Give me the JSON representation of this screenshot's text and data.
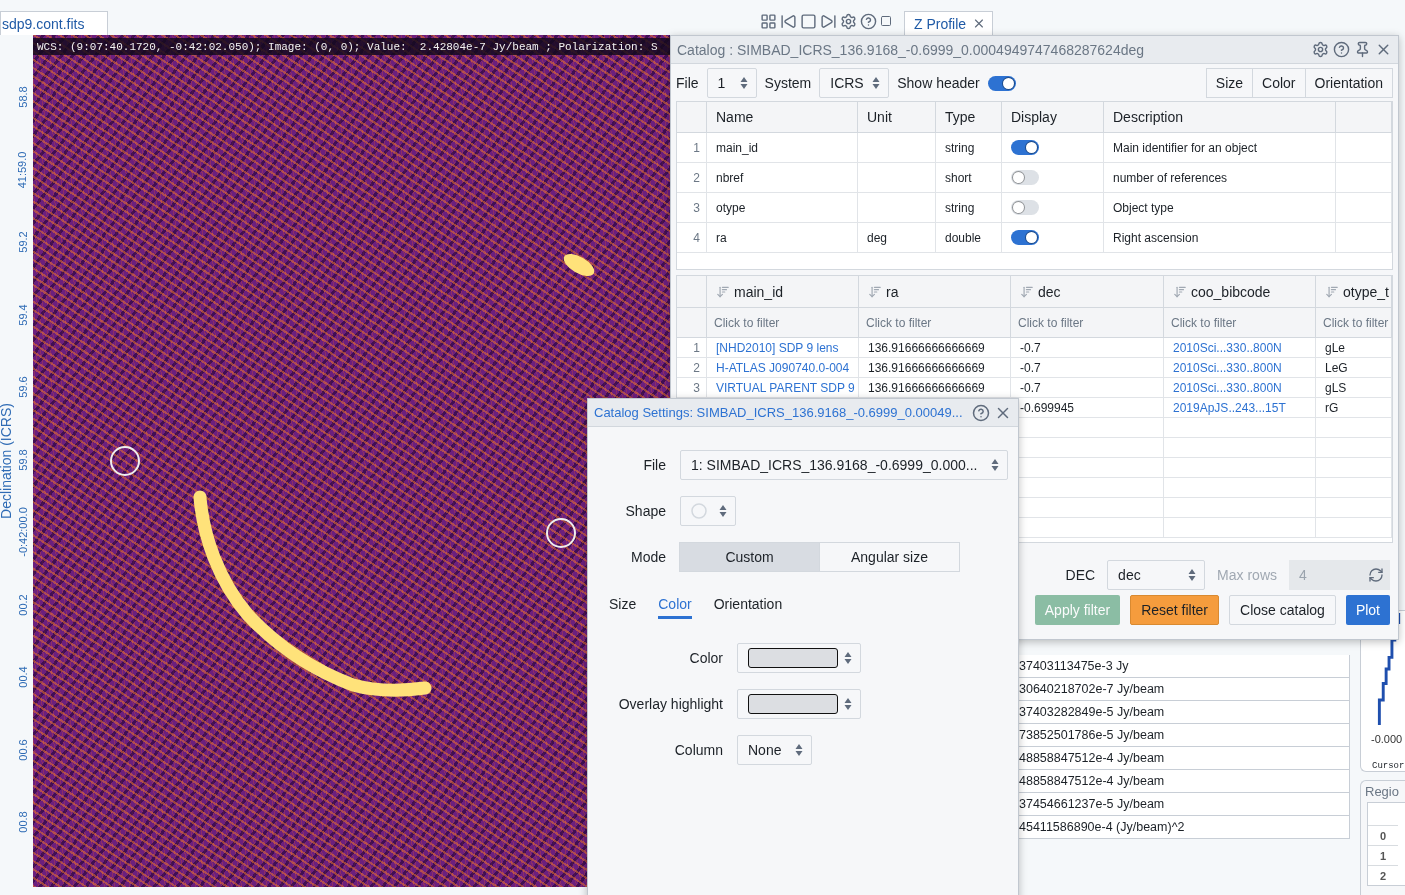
{
  "tabs": [
    {
      "label": "sdp9.cont.fits",
      "selected": true
    }
  ],
  "profile_tab": {
    "label": "Z Profile"
  },
  "image_viewer": {
    "cursor_info": "WCS: (9:07:40.1720, -0:42:02.050); Image: (0, 0); Value:  2.42804e-7 Jy/beam ; Polarization: S",
    "y_axis_title": "Declination (ICRS)",
    "y_ticks": [
      "58.8",
      "41:59.0",
      "59.2",
      "59.4",
      "59.6",
      "59.8",
      "-0:42:00.0",
      "00.2",
      "00.4",
      "00.6",
      "00.8"
    ]
  },
  "catalog": {
    "title": "Catalog : SIMBAD_ICRS_136.9168_-0.6999_0.0004949747468287624deg",
    "file_label": "File",
    "file": "1",
    "system_label": "System",
    "system": "ICRS",
    "show_header": {
      "label": "Show header",
      "on": true
    },
    "view_buttons": [
      "Size",
      "Color",
      "Orientation"
    ],
    "header_table": {
      "columns": [
        "Name",
        "Unit",
        "Type",
        "Display",
        "Description"
      ],
      "rows": [
        {
          "index": "1",
          "name": "main_id",
          "type": "string",
          "display": true,
          "description": "Main identifier for an object"
        },
        {
          "index": "2",
          "name": "nbref",
          "type": "short",
          "display": false,
          "description": "number of references"
        },
        {
          "index": "3",
          "name": "otype",
          "type": "string",
          "display": false,
          "description": "Object type"
        },
        {
          "index": "4",
          "name": "ra",
          "unit": "deg",
          "type": "double",
          "display": true,
          "description": "Right ascension"
        }
      ]
    },
    "data_table": {
      "columns": [
        {
          "name": "main_id",
          "kind": "link",
          "filter_placeholder": "Click to filter"
        },
        {
          "name": "ra",
          "kind": "text",
          "filter_placeholder": "Click to filter"
        },
        {
          "name": "dec",
          "kind": "text",
          "filter_placeholder": "Click to filter"
        },
        {
          "name": "coo_bibcode",
          "kind": "link",
          "filter_placeholder": "Click to filter"
        },
        {
          "name": "otype_t",
          "kind": "text",
          "filter_placeholder": "Click to filter"
        }
      ],
      "rows": [
        {
          "index": "1",
          "cells": [
            "[NHD2010] SDP 9 lens",
            "136.91666666666669",
            "-0.7",
            "2010Sci...330..800N",
            "gLe"
          ]
        },
        {
          "index": "2",
          "cells": [
            "H-ATLAS J090740.0-004",
            "136.91666666666669",
            "-0.7",
            "2010Sci...330..800N",
            "LeG"
          ]
        },
        {
          "index": "3",
          "cells": [
            "VIRTUAL PARENT SDP 9",
            "136.91666666666669",
            "-0.7",
            "2010Sci...330..800N",
            "gLS"
          ]
        },
        {
          "cells": [
            null,
            null,
            "-0.699945",
            "2019ApJS..243...15T",
            "rG"
          ]
        }
      ]
    },
    "controls": {
      "dec_label": "DEC",
      "dec": "dec",
      "max_rows": {
        "label": "Max rows",
        "value": "4",
        "disabled": true
      },
      "buttons": [
        {
          "label": "Apply filter",
          "kind": "success",
          "disabled": true
        },
        {
          "label": "Reset filter",
          "kind": "warning",
          "disabled": false
        },
        {
          "label": "Close catalog",
          "kind": "default",
          "disabled": false
        },
        {
          "label": "Plot",
          "kind": "primary",
          "disabled": false
        }
      ]
    }
  },
  "stats_table": {
    "rows": [
      "37403113475e-3 Jy",
      "30640218702e-7 Jy/beam",
      "37403282849e-5 Jy/beam",
      "73852501786e-5 Jy/beam",
      "48858847512e-4 Jy/beam",
      "48858847512e-4 Jy/beam",
      "37454661237e-5 Jy/beam",
      "45411586890e-4 (Jy/beam)^2"
    ]
  },
  "profile_chart": {
    "axis_label": "-0.000",
    "cursor_label": "Cursor"
  },
  "region_panel": {
    "title": "Regio",
    "rows": [
      "0",
      "1",
      "2"
    ]
  },
  "settings_dialog": {
    "title": "Catalog Settings: SIMBAD_ICRS_136.9168_-0.6999_0.00049...",
    "file_label": "File",
    "file": "1: SIMBAD_ICRS_136.9168_-0.6999_0.000...",
    "shape_label": "Shape",
    "mode_label": "Mode",
    "modes": [
      {
        "label": "Custom",
        "selected": true
      },
      {
        "label": "Angular size",
        "selected": false
      }
    ],
    "tabs": [
      {
        "label": "Size",
        "selected": false
      },
      {
        "label": "Color",
        "selected": true
      },
      {
        "label": "Orientation",
        "selected": false
      }
    ],
    "fields": [
      {
        "label": "Color",
        "kind": "color",
        "color": "#dcdee2"
      },
      {
        "label": "Overlay highlight",
        "kind": "color",
        "color": "#dcdee2"
      },
      {
        "label": "Column",
        "kind": "select",
        "value": "None"
      }
    ]
  }
}
